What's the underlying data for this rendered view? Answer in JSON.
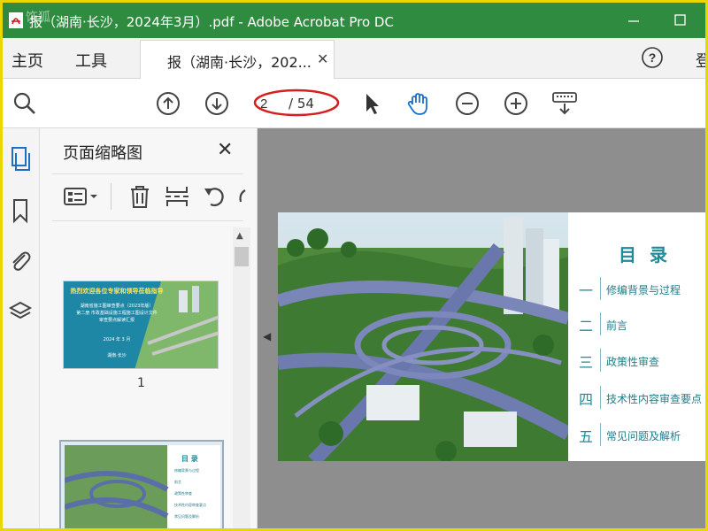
{
  "window": {
    "title": "报（湖南·长沙，2024年3月）.pdf - Adobe Acrobat Pro DC",
    "watermark": "饰狐",
    "accent": "#2e8b3f"
  },
  "tabs": {
    "home": "主页",
    "tools": "工具",
    "doc_tab": "报（湖南·长沙，202...",
    "login_partial": "登"
  },
  "toolbar": {
    "page_current": "2",
    "page_total": "/ 54",
    "icons": [
      "zoom-search-icon",
      "prev-page-icon",
      "next-page-icon",
      "select-arrow-icon",
      "hand-tool-icon",
      "zoom-out-icon",
      "zoom-in-icon",
      "keyboard-icon"
    ]
  },
  "panel": {
    "title": "页面缩略图",
    "thumb1_title": "热烈欢迎各位专家和领导莅临指导",
    "thumb1_line1": "湖南省施工图审查要点（2023年版）",
    "thumb1_line2": "第二册 市政基础设施工程施工图设计文件",
    "thumb1_line3": "审查要点解读汇报",
    "thumb1_date": "2024 年 3 月",
    "thumb1_place": "湖南·长沙",
    "thumb1_number": "1",
    "thumb2_title": "目 录",
    "thumb2_items": [
      "修编背景与过程",
      "前言",
      "政策性审查",
      "技术性内容审查要点",
      "常见问题及解析"
    ]
  },
  "toc": {
    "title": "目 录",
    "items": [
      {
        "num": "一",
        "text": "修编背景与过程"
      },
      {
        "num": "二",
        "text": "前言"
      },
      {
        "num": "三",
        "text": "政策性审查"
      },
      {
        "num": "四",
        "text": "技术性内容审查要点"
      },
      {
        "num": "五",
        "text": "常见问题及解析"
      }
    ]
  }
}
